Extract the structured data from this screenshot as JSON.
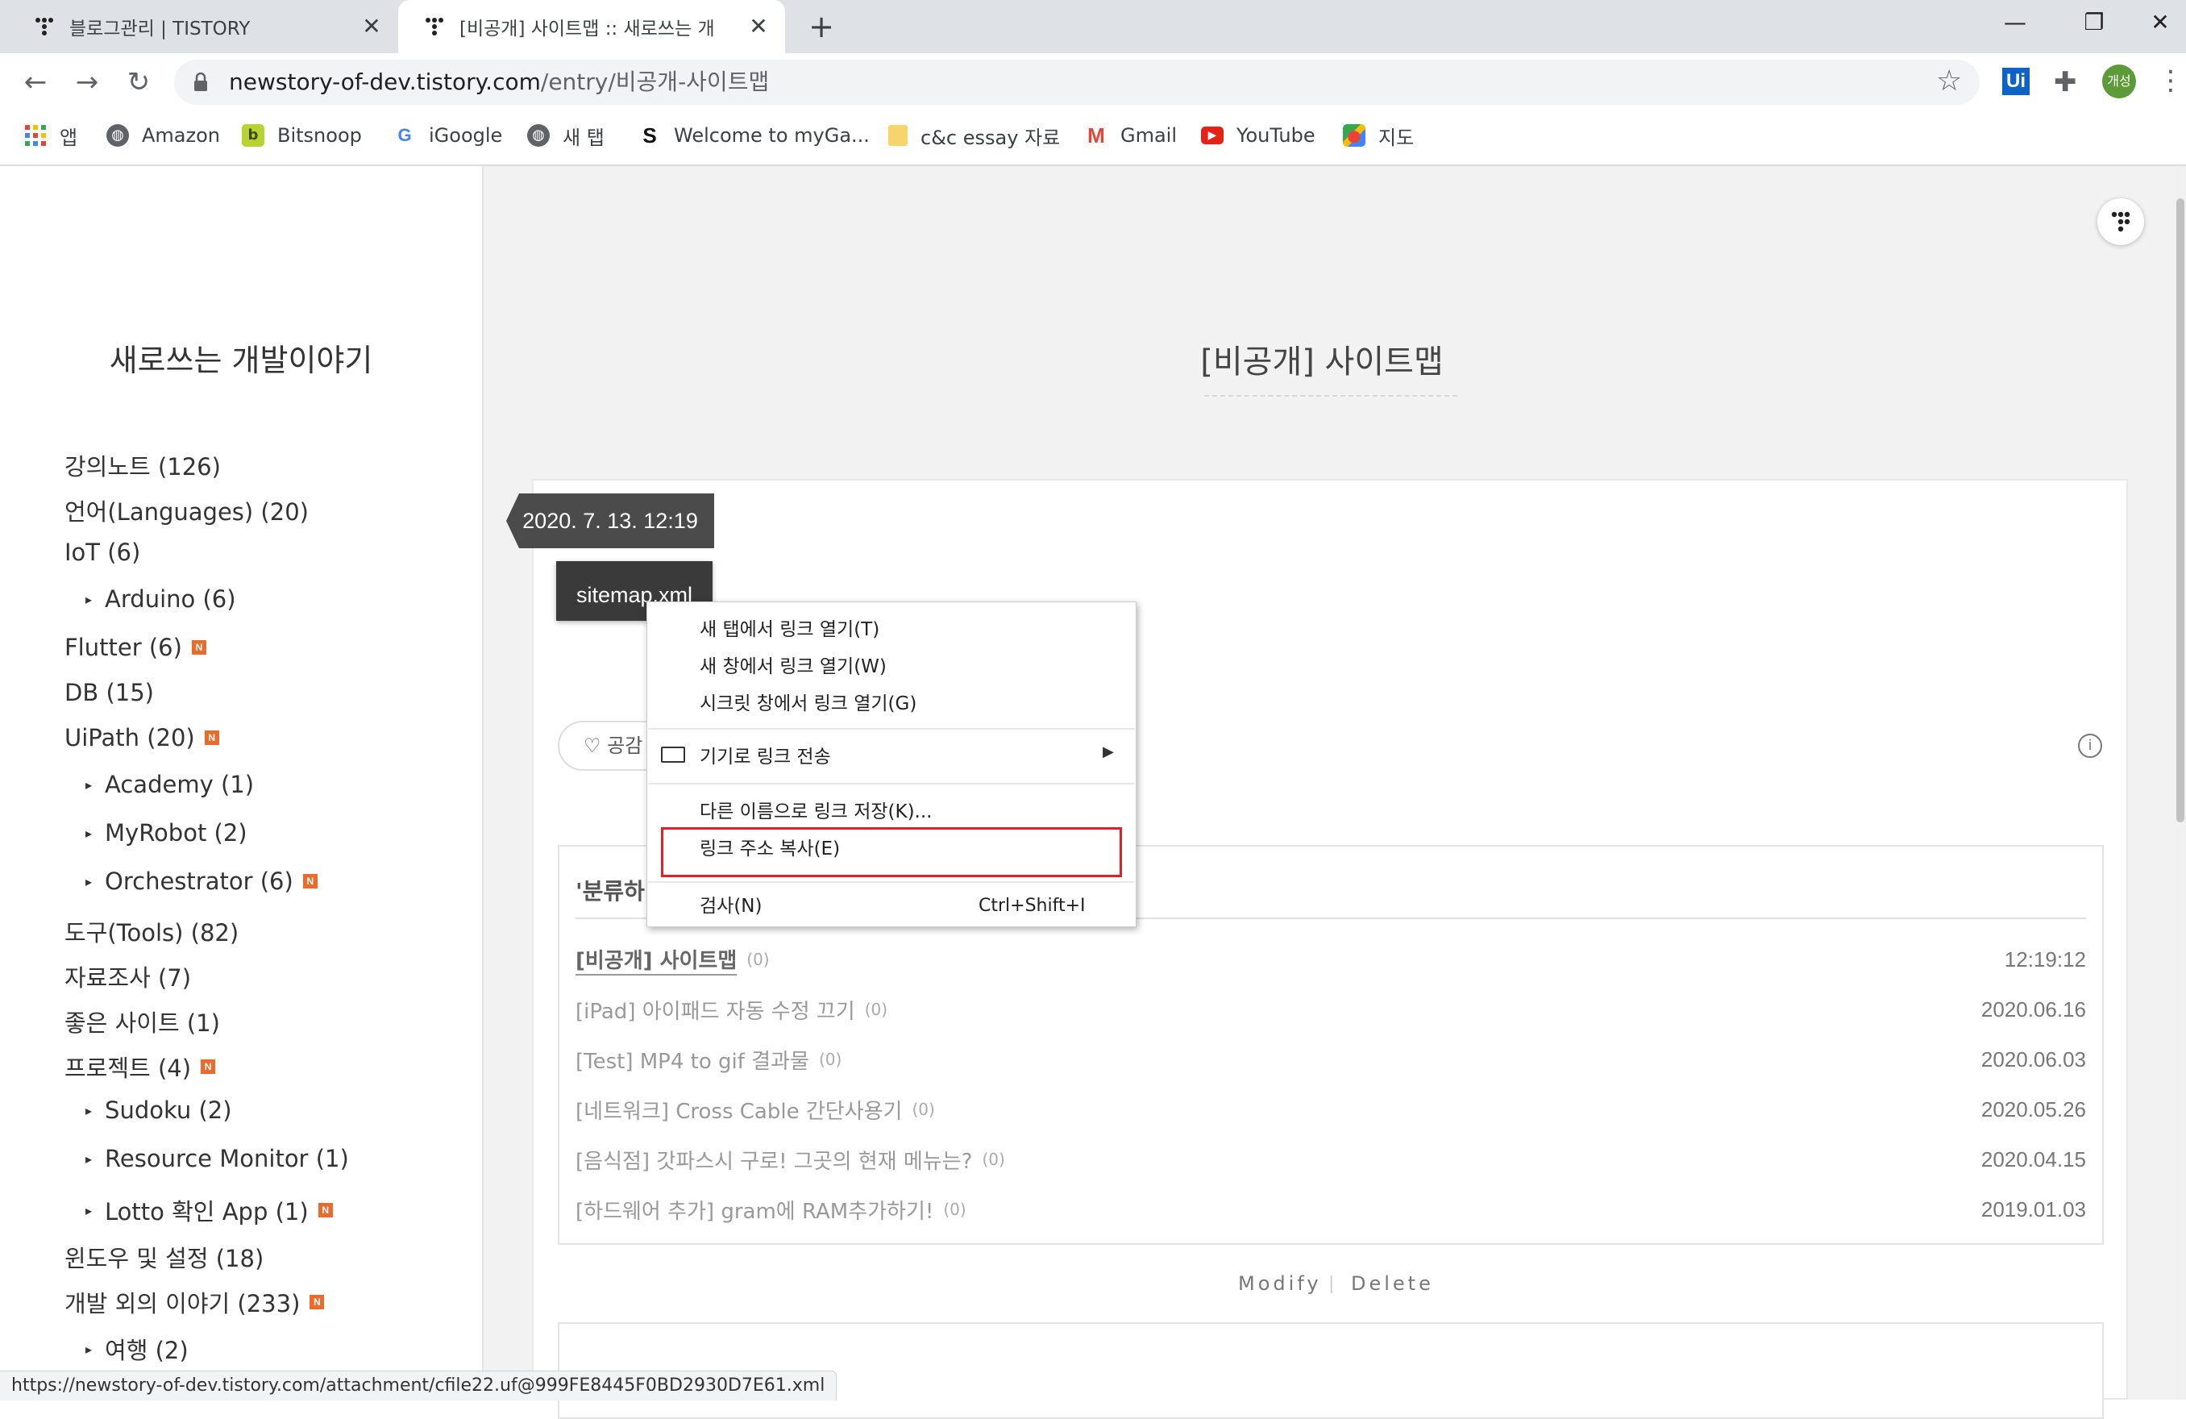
{
  "browser": {
    "tabs": [
      {
        "title": "블로그관리 | TISTORY",
        "active": false
      },
      {
        "title": "[비공개] 사이트맵 :: 새로쓰는 개",
        "active": true
      }
    ],
    "url_host": "newstory-of-dev.tistory.com",
    "url_path": "/entry/비공개-사이트맵",
    "avatar_label": "개성",
    "ext_label": "Ui",
    "bookmarks": [
      {
        "label": "앱",
        "icon": "apps-grid-icon"
      },
      {
        "label": "Amazon",
        "icon": "globe-icon"
      },
      {
        "label": "Bitsnoop",
        "icon": "bitsnoop-icon"
      },
      {
        "label": "iGoogle",
        "icon": "google-icon"
      },
      {
        "label": "새 탭",
        "icon": "globe-icon"
      },
      {
        "label": "Welcome to myGa...",
        "icon": "s-logo-icon"
      },
      {
        "label": "c&c essay 자료",
        "icon": "folder-icon"
      },
      {
        "label": "Gmail",
        "icon": "gmail-icon"
      },
      {
        "label": "YouTube",
        "icon": "youtube-icon"
      },
      {
        "label": "지도",
        "icon": "maps-icon"
      }
    ],
    "status_url": "https://newstory-of-dev.tistory.com/attachment/cfile22.uf@999FE8445F0BD2930D7E61.xml"
  },
  "sidebar": {
    "blog_title": "새로쓰는 개발이야기",
    "categories": [
      {
        "label": "강의노트 (126)",
        "sub": false,
        "new": false
      },
      {
        "label": "언어(Languages) (20)",
        "sub": false,
        "new": false
      },
      {
        "label": "IoT (6)",
        "sub": false,
        "new": false
      },
      {
        "label": "Arduino (6)",
        "sub": true,
        "new": false
      },
      {
        "label": "Flutter (6)",
        "sub": false,
        "new": true
      },
      {
        "label": "DB (15)",
        "sub": false,
        "new": false
      },
      {
        "label": "UiPath (20)",
        "sub": false,
        "new": true
      },
      {
        "label": "Academy (1)",
        "sub": true,
        "new": false
      },
      {
        "label": "MyRobot (2)",
        "sub": true,
        "new": false
      },
      {
        "label": "Orchestrator (6)",
        "sub": true,
        "new": true
      },
      {
        "label": "도구(Tools) (82)",
        "sub": false,
        "new": false
      },
      {
        "label": "자료조사 (7)",
        "sub": false,
        "new": false
      },
      {
        "label": "좋은 사이트 (1)",
        "sub": false,
        "new": false
      },
      {
        "label": "프로젝트 (4)",
        "sub": false,
        "new": true
      },
      {
        "label": "Sudoku (2)",
        "sub": true,
        "new": false
      },
      {
        "label": "Resource Monitor (1)",
        "sub": true,
        "new": false
      },
      {
        "label": "Lotto 확인 App (1)",
        "sub": true,
        "new": true
      },
      {
        "label": "윈도우 및 설정 (18)",
        "sub": false,
        "new": false
      },
      {
        "label": "개발 외의 이야기 (233)",
        "sub": false,
        "new": true
      },
      {
        "label": "여행 (2)",
        "sub": true,
        "new": false
      }
    ],
    "new_badge": "N"
  },
  "post": {
    "title": "[비공개] 사이트맵",
    "date": "2020. 7. 13. 12:19",
    "attachment": "sitemap.xml",
    "like_label": "공감",
    "related_heading": "'분류하",
    "related": [
      {
        "title": "[비공개] 사이트맵",
        "count": "(0)",
        "date": "12:19:12",
        "current": true
      },
      {
        "title": "[iPad] 아이패드 자동 수정 끄기",
        "count": "(0)",
        "date": "2020.06.16",
        "current": false
      },
      {
        "title": "[Test] MP4 to gif 결과물",
        "count": "(0)",
        "date": "2020.06.03",
        "current": false
      },
      {
        "title": "[네트워크] Cross Cable 간단사용기",
        "count": "(0)",
        "date": "2020.05.26",
        "current": false
      },
      {
        "title": "[음식점] 갓파스시 구로! 그곳의 현재 메뉴는?",
        "count": "(0)",
        "date": "2020.04.15",
        "current": false
      },
      {
        "title": "[하드웨어 추가] gram에 RAM추가하기!",
        "count": "(0)",
        "date": "2019.01.03",
        "current": false
      }
    ],
    "modify_label": "Modify",
    "delete_label": "Delete"
  },
  "context_menu": {
    "items": [
      {
        "label": "새 탭에서 링크 열기(T)"
      },
      {
        "label": "새 창에서 링크 열기(W)"
      },
      {
        "label": "시크릿 창에서 링크 열기(G)"
      },
      {
        "label": "기기로 링크 전송"
      },
      {
        "label": "다른 이름으로 링크 저장(K)..."
      },
      {
        "label": "링크 주소 복사(E)"
      },
      {
        "label": "검사(N)"
      }
    ],
    "inspect_shortcut": "Ctrl+Shift+I"
  },
  "colors": {
    "highlight_box": "#e0202a",
    "new_badge": "#ea6b2c",
    "tab_strip": "#dee1e6"
  }
}
